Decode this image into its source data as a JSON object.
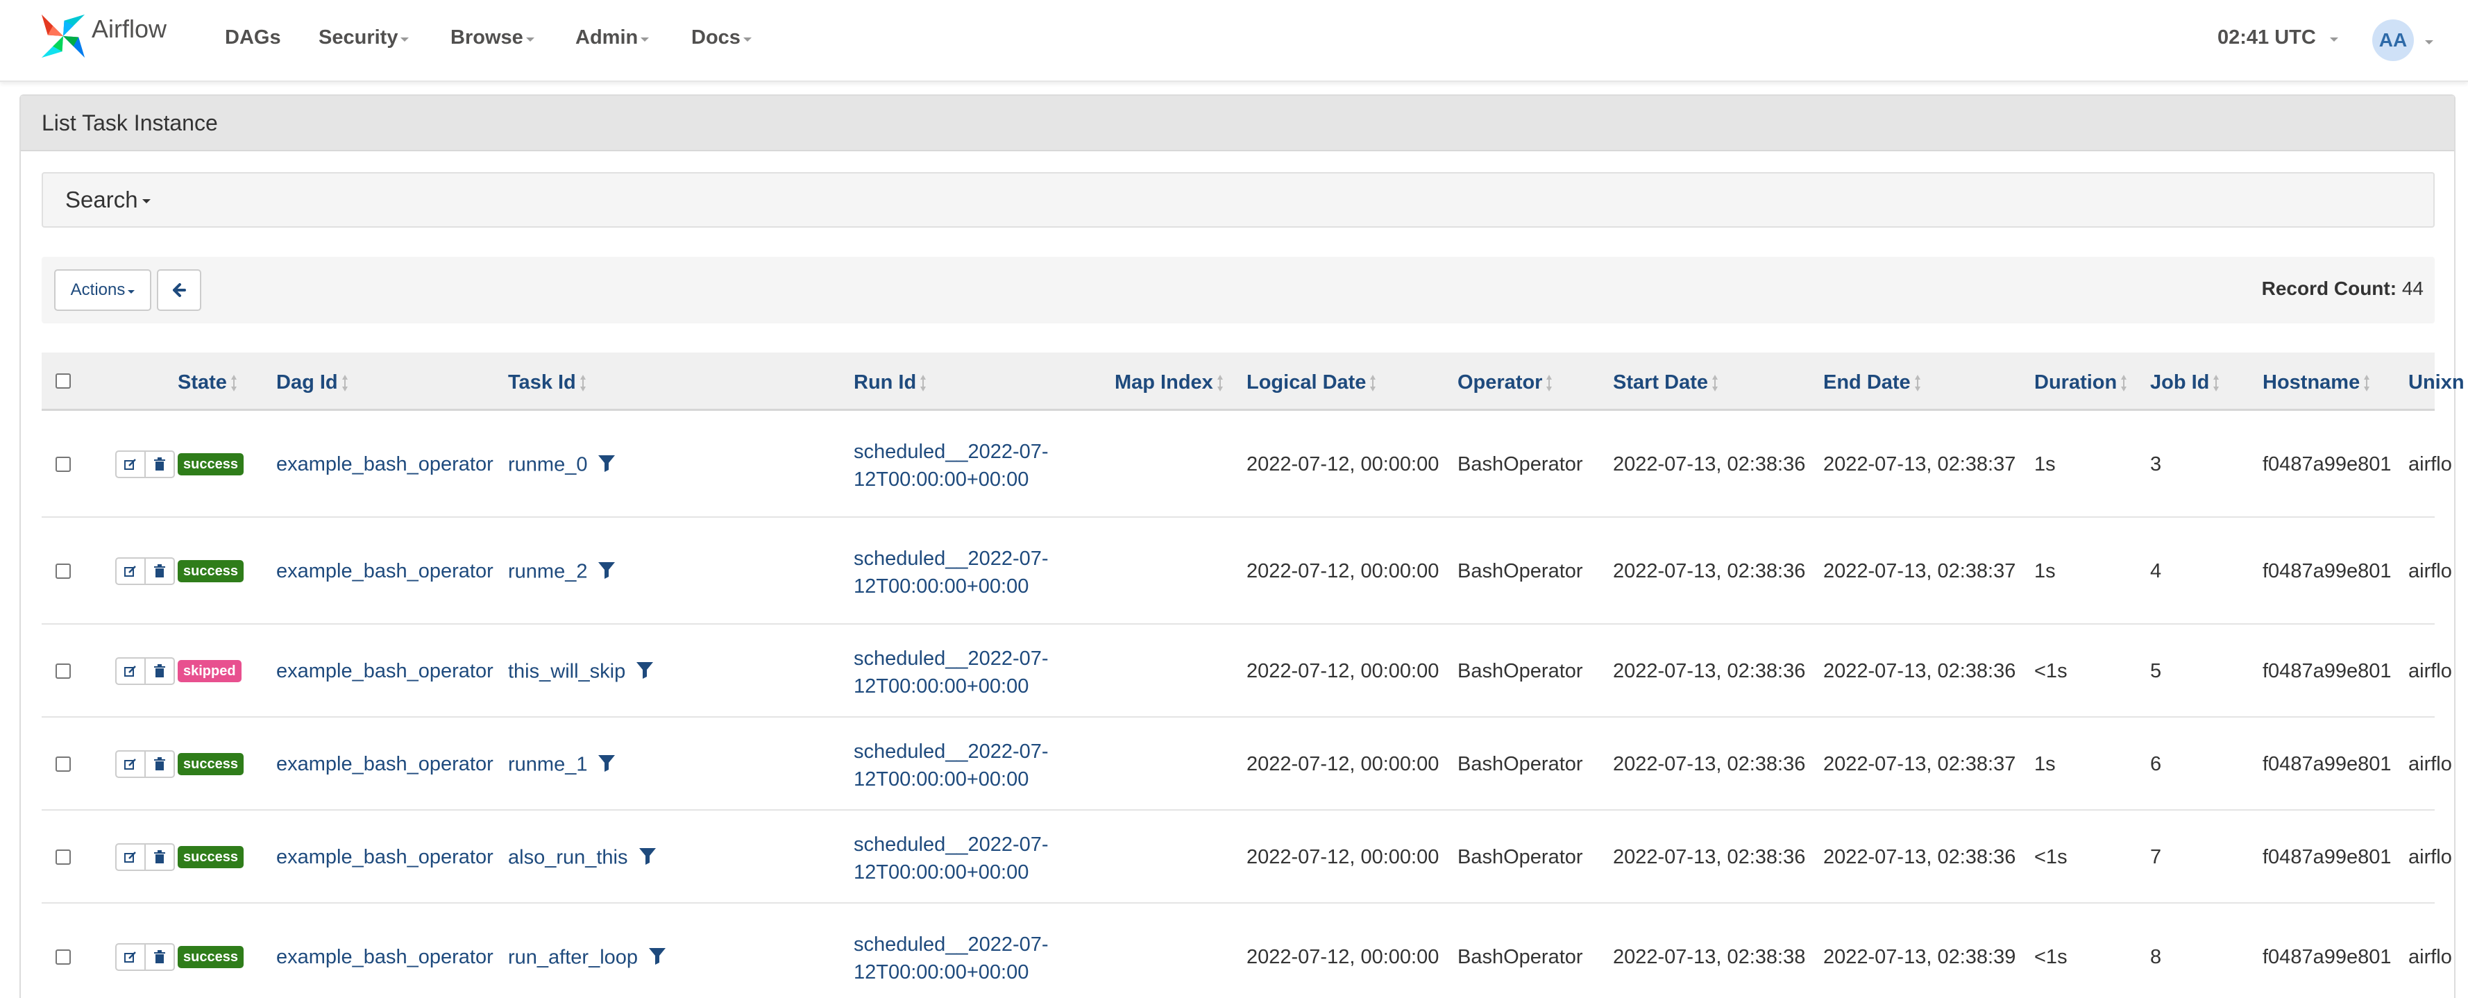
{
  "navbar": {
    "brand": "Airflow",
    "items": [
      {
        "label": "DAGs",
        "has_caret": false
      },
      {
        "label": "Security",
        "has_caret": true
      },
      {
        "label": "Browse",
        "has_caret": true
      },
      {
        "label": "Admin",
        "has_caret": true
      },
      {
        "label": "Docs",
        "has_caret": true
      }
    ],
    "clock": "02:41 UTC",
    "user_initials": "AA"
  },
  "panel": {
    "title": "List Task Instance",
    "search_label": "Search",
    "actions_label": "Actions",
    "back_icon": "arrow-left-icon",
    "record_count_label": "Record Count:",
    "record_count_value": "44"
  },
  "table": {
    "columns": [
      "State",
      "Dag Id",
      "Task Id",
      "Run Id",
      "Map Index",
      "Logical Date",
      "Operator",
      "Start Date",
      "End Date",
      "Duration",
      "Job Id",
      "Hostname",
      "Unixn"
    ],
    "rows": [
      {
        "state": "success",
        "dag_id": "example_bash_operator",
        "task_id": "runme_0",
        "run_id_line1": "scheduled__2022-07-",
        "run_id_line2": "12T00:00:00+00:00",
        "map_index": "",
        "logical_date": "2022-07-12, 00:00:00",
        "operator": "BashOperator",
        "start_date": "2022-07-13, 02:38:36",
        "end_date": "2022-07-13, 02:38:37",
        "duration": "1s",
        "job_id": "3",
        "hostname": "f0487a99e801",
        "unixname": "airflo"
      },
      {
        "state": "success",
        "dag_id": "example_bash_operator",
        "task_id": "runme_2",
        "run_id_line1": "scheduled__2022-07-",
        "run_id_line2": "12T00:00:00+00:00",
        "map_index": "",
        "logical_date": "2022-07-12, 00:00:00",
        "operator": "BashOperator",
        "start_date": "2022-07-13, 02:38:36",
        "end_date": "2022-07-13, 02:38:37",
        "duration": "1s",
        "job_id": "4",
        "hostname": "f0487a99e801",
        "unixname": "airflo"
      },
      {
        "state": "skipped",
        "dag_id": "example_bash_operator",
        "task_id": "this_will_skip",
        "run_id_line1": "scheduled__2022-07-",
        "run_id_line2": "12T00:00:00+00:00",
        "map_index": "",
        "logical_date": "2022-07-12, 00:00:00",
        "operator": "BashOperator",
        "start_date": "2022-07-13, 02:38:36",
        "end_date": "2022-07-13, 02:38:36",
        "duration": "<1s",
        "job_id": "5",
        "hostname": "f0487a99e801",
        "unixname": "airflo"
      },
      {
        "state": "success",
        "dag_id": "example_bash_operator",
        "task_id": "runme_1",
        "run_id_line1": "scheduled__2022-07-",
        "run_id_line2": "12T00:00:00+00:00",
        "map_index": "",
        "logical_date": "2022-07-12, 00:00:00",
        "operator": "BashOperator",
        "start_date": "2022-07-13, 02:38:36",
        "end_date": "2022-07-13, 02:38:37",
        "duration": "1s",
        "job_id": "6",
        "hostname": "f0487a99e801",
        "unixname": "airflo"
      },
      {
        "state": "success",
        "dag_id": "example_bash_operator",
        "task_id": "also_run_this",
        "run_id_line1": "scheduled__2022-07-",
        "run_id_line2": "12T00:00:00+00:00",
        "map_index": "",
        "logical_date": "2022-07-12, 00:00:00",
        "operator": "BashOperator",
        "start_date": "2022-07-13, 02:38:36",
        "end_date": "2022-07-13, 02:38:36",
        "duration": "<1s",
        "job_id": "7",
        "hostname": "f0487a99e801",
        "unixname": "airflo"
      },
      {
        "state": "success",
        "dag_id": "example_bash_operator",
        "task_id": "run_after_loop",
        "run_id_line1": "scheduled__2022-07-",
        "run_id_line2": "12T00:00:00+00:00",
        "map_index": "",
        "logical_date": "2022-07-12, 00:00:00",
        "operator": "BashOperator",
        "start_date": "2022-07-13, 02:38:38",
        "end_date": "2022-07-13, 02:38:39",
        "duration": "<1s",
        "job_id": "8",
        "hostname": "f0487a99e801",
        "unixname": "airflo"
      }
    ]
  },
  "colors": {
    "success": "#2f7d1a",
    "skipped": "#e8508f",
    "link": "#1e4a7d"
  },
  "icons": {
    "edit": "edit-icon",
    "delete": "trash-icon",
    "filter": "filter-icon"
  }
}
